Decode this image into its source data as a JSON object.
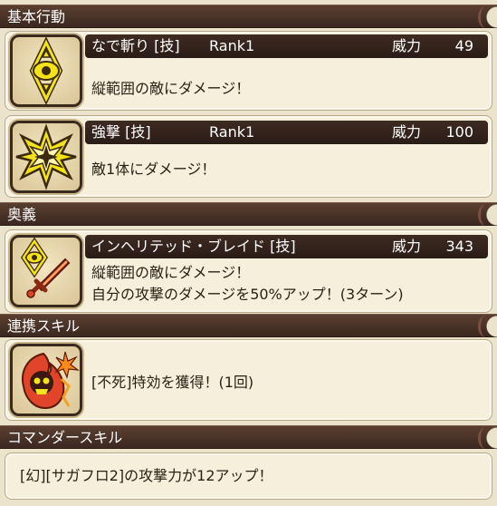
{
  "sections": {
    "basic": "基本行動",
    "ougi": "奥義",
    "renkei": "連携スキル",
    "commander": "コマンダースキル"
  },
  "labels": {
    "power": "威力"
  },
  "skills": [
    {
      "name": "なで斬り [技]",
      "rank": "Rank1",
      "power": "49",
      "desc": "縦範囲の敵にダメージ！",
      "icon": "vertical-range-eye-icon"
    },
    {
      "name": "強撃 [技]",
      "rank": "Rank1",
      "power": "100",
      "desc": "敵1体にダメージ！",
      "icon": "single-target-burst-icon"
    }
  ],
  "ougi": {
    "name": "インヘリテッド・ブレイド [技]",
    "power": "343",
    "desc_line1": "縦範囲の敵にダメージ！",
    "desc_line2": "自分の攻撃のダメージを50%アップ！(3ターン)",
    "icon": "eye-and-sword-icon"
  },
  "renkei": {
    "desc": "[不死]特効を獲得！(1回)",
    "icon": "undead-flame-skull-icon"
  },
  "commander": {
    "desc": "[幻][サガフロ2]の攻撃力が12アップ！"
  },
  "colors": {
    "header_bg": "#4a3428",
    "card_bg": "#f6efdc",
    "icon_yellow": "#f4e21a",
    "icon_red": "#e0452a"
  }
}
